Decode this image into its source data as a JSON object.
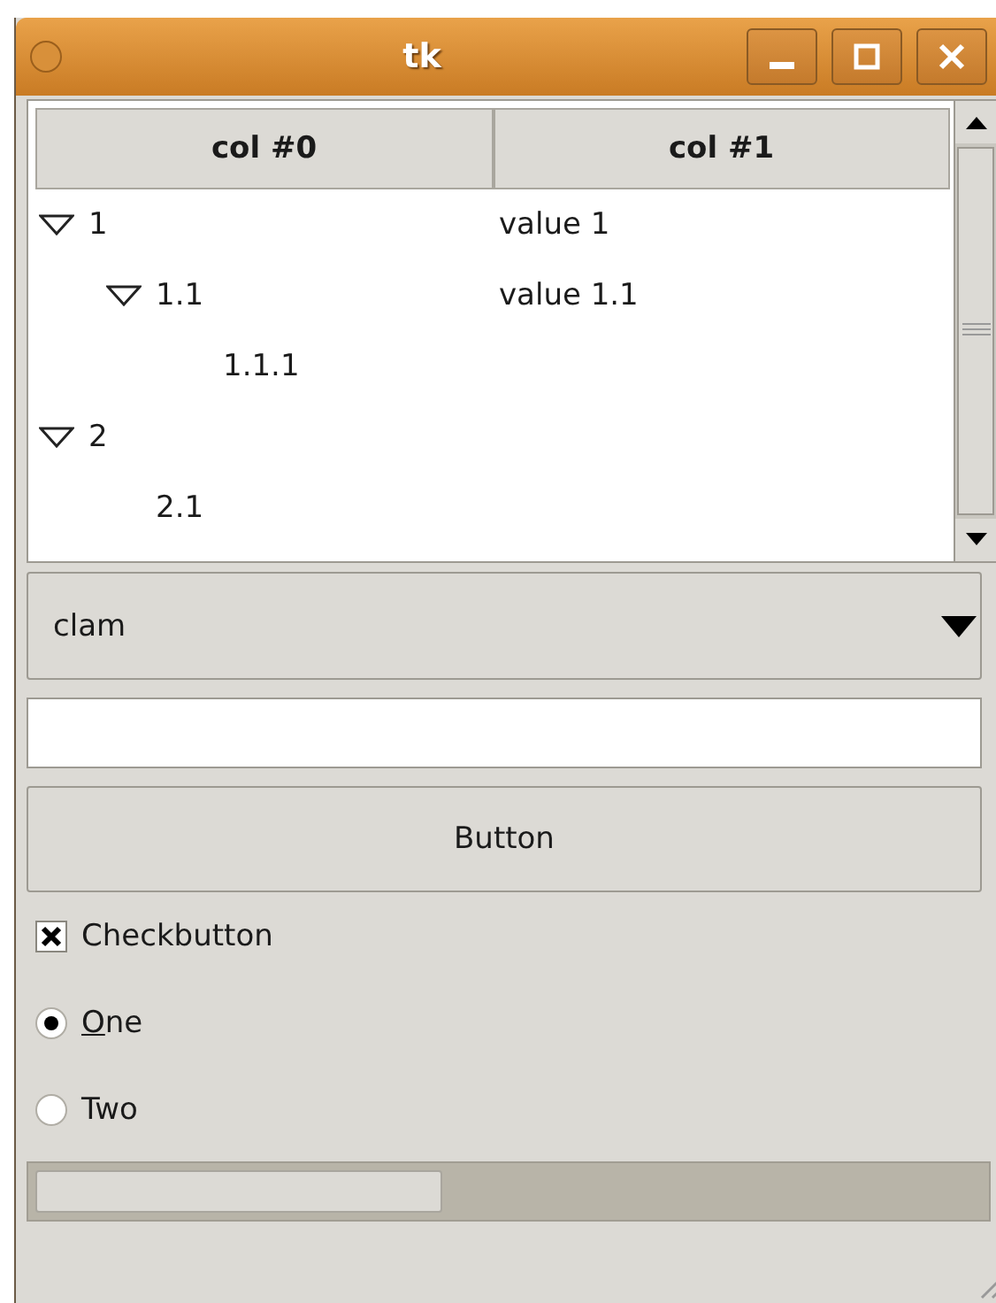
{
  "window": {
    "title": "tk"
  },
  "tree": {
    "columns": [
      "col #0",
      "col #1"
    ],
    "rows": [
      {
        "label": "1",
        "value": "value 1",
        "expanded": true,
        "children": [
          {
            "label": "1.1",
            "value": "value 1.1",
            "expanded": true,
            "children": [
              {
                "label": "1.1.1"
              }
            ]
          }
        ]
      },
      {
        "label": "2",
        "expanded": true,
        "children": [
          {
            "label": "2.1"
          }
        ]
      }
    ]
  },
  "combobox": {
    "value": "clam"
  },
  "button": {
    "label": "Button"
  },
  "checkbutton": {
    "label": "Checkbutton",
    "checked": true
  },
  "radios": [
    {
      "label": "One",
      "selected": true,
      "underline_first": true
    },
    {
      "label": "Two",
      "selected": false,
      "underline_first": false
    }
  ],
  "progress": {
    "level": 0.43
  }
}
